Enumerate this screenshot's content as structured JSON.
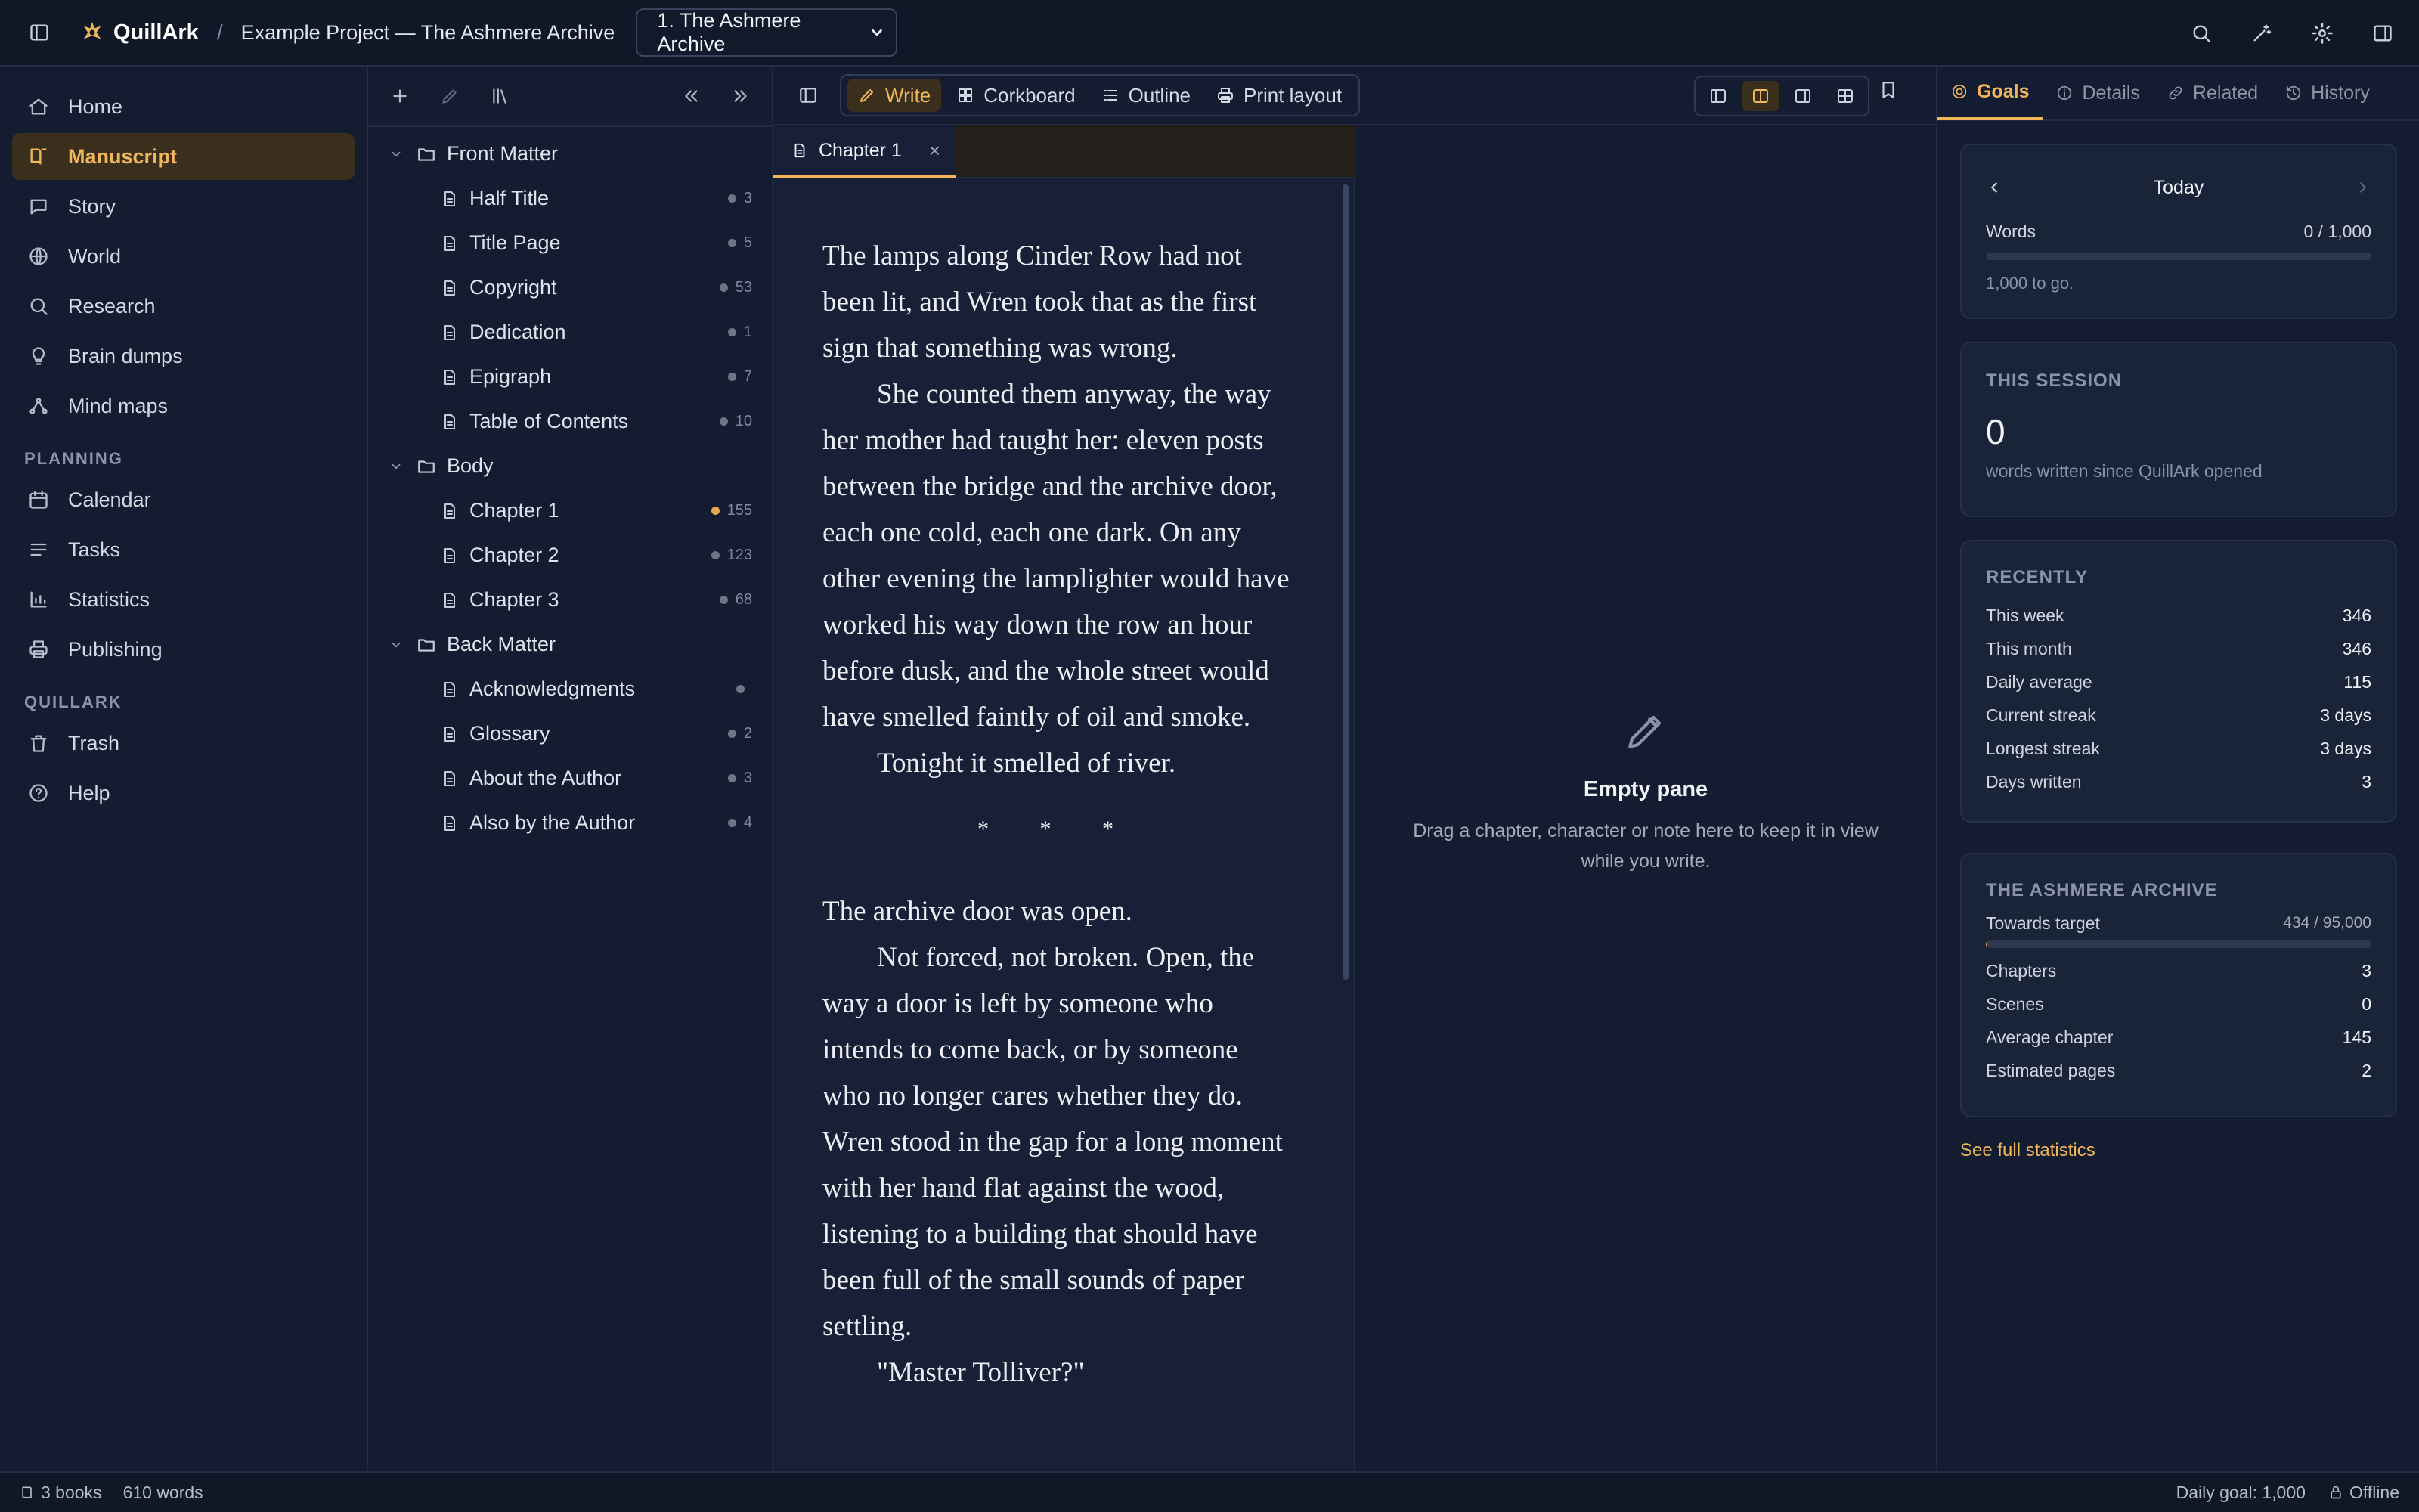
{
  "app": {
    "name": "QuillArk"
  },
  "breadcrumb": {
    "project": "Example Project — The Ashmere Archive"
  },
  "book_select": {
    "selected": "1. The Ashmere Archive"
  },
  "nav": {
    "items": [
      {
        "label": "Home",
        "icon": "home-icon"
      },
      {
        "label": "Manuscript",
        "icon": "book-icon",
        "active": true
      },
      {
        "label": "Story",
        "icon": "speech-bubble-icon"
      },
      {
        "label": "World",
        "icon": "globe-icon"
      },
      {
        "label": "Research",
        "icon": "search-icon"
      },
      {
        "label": "Brain dumps",
        "icon": "lightbulb-icon"
      },
      {
        "label": "Mind maps",
        "icon": "mindmap-icon"
      }
    ],
    "planning_label": "PLANNING",
    "planning_items": [
      {
        "label": "Calendar",
        "icon": "calendar-icon"
      },
      {
        "label": "Tasks",
        "icon": "list-icon"
      },
      {
        "label": "Statistics",
        "icon": "bar-chart-icon"
      },
      {
        "label": "Publishing",
        "icon": "printer-icon"
      }
    ],
    "quillark_label": "QUILLARK",
    "quillark_items": [
      {
        "label": "Trash",
        "icon": "trash-icon"
      },
      {
        "label": "Help",
        "icon": "help-circle-icon"
      }
    ]
  },
  "binder": {
    "folders": [
      {
        "name": "Front Matter",
        "docs": [
          {
            "name": "Half Title",
            "count": "3"
          },
          {
            "name": "Title Page",
            "count": "5"
          },
          {
            "name": "Copyright",
            "count": "53"
          },
          {
            "name": "Dedication",
            "count": "1"
          },
          {
            "name": "Epigraph",
            "count": "7"
          },
          {
            "name": "Table of Contents",
            "count": "10"
          }
        ]
      },
      {
        "name": "Body",
        "docs": [
          {
            "name": "Chapter 1",
            "count": "155",
            "active": true
          },
          {
            "name": "Chapter 2",
            "count": "123"
          },
          {
            "name": "Chapter 3",
            "count": "68"
          }
        ]
      },
      {
        "name": "Back Matter",
        "docs": [
          {
            "name": "Acknowledgments",
            "count": ""
          },
          {
            "name": "Glossary",
            "count": "2"
          },
          {
            "name": "About the Author",
            "count": "3"
          },
          {
            "name": "Also by the Author",
            "count": "4"
          }
        ]
      }
    ]
  },
  "editor": {
    "modes": {
      "write": "Write",
      "corkboard": "Corkboard",
      "outline": "Outline",
      "print": "Print layout"
    },
    "tab_title": "Chapter 1",
    "paragraphs": [
      "The lamps along Cinder Row had not been lit, and Wren took that as the first sign that something was wrong.",
      "She counted them anyway, the way her mother had taught her: eleven posts between the bridge and the archive door, each one cold, each one dark. On any other evening the lamplighter would have worked his way down the row an hour before dusk, and the whole street would have smelled faintly of oil and smoke.",
      "Tonight it smelled of river."
    ],
    "scene_break": "* * *",
    "paragraphs2": [
      "The archive door was open.",
      "Not forced, not broken. Open, the way a door is left by someone who intends to come back, or by someone who no longer cares whether they do. Wren stood in the gap for a long moment with her hand flat against the wood, listening to a building that should have been full of the small sounds of paper settling.",
      "\"Master Tolliver?\""
    ]
  },
  "empty_pane": {
    "title": "Empty pane",
    "description": "Drag a chapter, character or note here to keep it in view while you write."
  },
  "right_panel": {
    "tabs": {
      "goals": "Goals",
      "details": "Details",
      "related": "Related",
      "history": "History"
    },
    "today": {
      "label": "Today",
      "words_label": "Words",
      "words_value": "0 / 1,000",
      "progress": 0,
      "to_go": "1,000 to go."
    },
    "session": {
      "heading": "THIS SESSION",
      "value": "0",
      "caption": "words written since QuillArk opened"
    },
    "recently": {
      "heading": "RECENTLY",
      "rows": [
        {
          "label": "This week",
          "value": "346"
        },
        {
          "label": "This month",
          "value": "346"
        },
        {
          "label": "Daily average",
          "value": "115"
        },
        {
          "label": "Current streak",
          "value": "3 days"
        },
        {
          "label": "Longest streak",
          "value": "3 days"
        },
        {
          "label": "Days written",
          "value": "3"
        }
      ]
    },
    "book": {
      "heading": "THE ASHMERE ARCHIVE",
      "target_label": "Towards target",
      "target_value": "434 / 95,000",
      "progress": 0.0046,
      "rows": [
        {
          "label": "Chapters",
          "value": "3"
        },
        {
          "label": "Scenes",
          "value": "0"
        },
        {
          "label": "Average chapter",
          "value": "145"
        },
        {
          "label": "Estimated pages",
          "value": "2"
        }
      ]
    },
    "see_full": "See full statistics"
  },
  "status": {
    "books": "3 books",
    "words": "610 words",
    "daily_goal": "Daily goal: 1,000",
    "offline": "Offline"
  },
  "colors": {
    "accent": "#f0b65c",
    "background": "#131c30",
    "panel": "#1a2438"
  }
}
